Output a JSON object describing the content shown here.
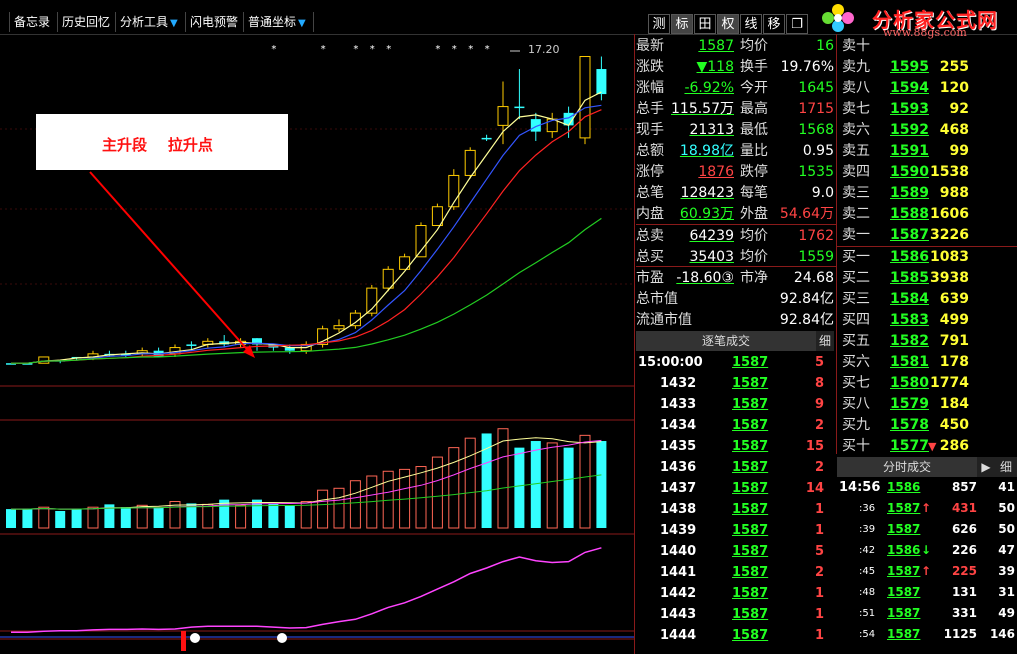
{
  "toolbar": {
    "items": [
      {
        "label": "备忘录"
      },
      {
        "label": "历史回忆"
      },
      {
        "label": "分析工具",
        "dropdown": true
      },
      {
        "label": "闪电预警"
      },
      {
        "label": "普通坐标",
        "dropdown": true
      }
    ],
    "right_buttons": [
      "测",
      "标",
      "田",
      "权",
      "线",
      "移",
      "❐"
    ],
    "brand_name": "分析家公式网",
    "brand_url": "www.88gs.com"
  },
  "annotation": {
    "text": "主升段    拉升点"
  },
  "chart_data": [
    {
      "type": "candlestick",
      "title": "",
      "xlabel": "",
      "ylabel": "",
      "peak_label": "17.20",
      "candles": [
        {
          "o": 12.3,
          "c": 12.3,
          "h": 12.3,
          "l": 12.3,
          "up": false
        },
        {
          "o": 12.3,
          "c": 12.3,
          "h": 12.3,
          "l": 12.3,
          "up": false
        },
        {
          "o": 12.3,
          "c": 12.4,
          "h": 12.4,
          "l": 12.3,
          "up": true
        },
        {
          "o": 12.35,
          "c": 12.35,
          "h": 12.35,
          "l": 12.3,
          "up": false
        },
        {
          "o": 12.4,
          "c": 12.4,
          "h": 12.4,
          "l": 12.35,
          "up": false
        },
        {
          "o": 12.4,
          "c": 12.45,
          "h": 12.5,
          "l": 12.35,
          "up": true
        },
        {
          "o": 12.45,
          "c": 12.45,
          "h": 12.5,
          "l": 12.4,
          "up": false
        },
        {
          "o": 12.45,
          "c": 12.45,
          "h": 12.5,
          "l": 12.4,
          "up": false
        },
        {
          "o": 12.45,
          "c": 12.5,
          "h": 12.55,
          "l": 12.4,
          "up": true
        },
        {
          "o": 12.5,
          "c": 12.4,
          "h": 12.55,
          "l": 12.4,
          "up": false
        },
        {
          "o": 12.45,
          "c": 12.55,
          "h": 12.6,
          "l": 12.4,
          "up": true
        },
        {
          "o": 12.6,
          "c": 12.6,
          "h": 12.65,
          "l": 12.5,
          "up": false
        },
        {
          "o": 12.6,
          "c": 12.65,
          "h": 12.7,
          "l": 12.55,
          "up": true
        },
        {
          "o": 12.65,
          "c": 12.6,
          "h": 12.75,
          "l": 12.55,
          "up": false
        },
        {
          "o": 12.6,
          "c": 12.65,
          "h": 12.7,
          "l": 12.55,
          "up": true
        },
        {
          "o": 12.7,
          "c": 12.6,
          "h": 12.7,
          "l": 12.5,
          "up": false
        },
        {
          "o": 12.6,
          "c": 12.55,
          "h": 12.6,
          "l": 12.5,
          "up": false
        },
        {
          "o": 12.55,
          "c": 12.5,
          "h": 12.6,
          "l": 12.45,
          "up": false
        },
        {
          "o": 12.5,
          "c": 12.6,
          "h": 12.65,
          "l": 12.45,
          "up": true
        },
        {
          "o": 12.6,
          "c": 12.85,
          "h": 12.9,
          "l": 12.55,
          "up": true
        },
        {
          "o": 12.85,
          "c": 12.9,
          "h": 13.0,
          "l": 12.8,
          "up": true
        },
        {
          "o": 12.9,
          "c": 13.1,
          "h": 13.15,
          "l": 12.85,
          "up": true
        },
        {
          "o": 13.1,
          "c": 13.5,
          "h": 13.55,
          "l": 13.05,
          "up": true
        },
        {
          "o": 13.5,
          "c": 13.8,
          "h": 13.85,
          "l": 13.45,
          "up": true
        },
        {
          "o": 13.8,
          "c": 14.0,
          "h": 14.05,
          "l": 13.8,
          "up": true
        },
        {
          "o": 14.0,
          "c": 14.5,
          "h": 14.55,
          "l": 14.0,
          "up": true
        },
        {
          "o": 14.5,
          "c": 14.8,
          "h": 14.85,
          "l": 14.5,
          "up": true
        },
        {
          "o": 14.8,
          "c": 15.3,
          "h": 15.4,
          "l": 14.75,
          "up": true
        },
        {
          "o": 15.3,
          "c": 15.7,
          "h": 15.75,
          "l": 15.25,
          "up": true
        },
        {
          "o": 15.9,
          "c": 15.9,
          "h": 15.95,
          "l": 15.85,
          "up": false
        },
        {
          "o": 16.1,
          "c": 16.4,
          "h": 16.8,
          "l": 15.8,
          "up": true
        },
        {
          "o": 16.4,
          "c": 16.4,
          "h": 17.0,
          "l": 16.2,
          "up": false
        },
        {
          "o": 16.2,
          "c": 16.0,
          "h": 16.3,
          "l": 15.85,
          "up": false
        },
        {
          "o": 16.0,
          "c": 16.2,
          "h": 16.3,
          "l": 15.9,
          "up": true
        },
        {
          "o": 16.3,
          "c": 16.1,
          "h": 16.4,
          "l": 15.9,
          "up": false
        },
        {
          "o": 15.9,
          "c": 17.2,
          "h": 17.2,
          "l": 15.8,
          "up": true
        },
        {
          "o": 17.0,
          "c": 16.6,
          "h": 17.2,
          "l": 16.5,
          "up": false
        }
      ],
      "volume": [
        20,
        20,
        22,
        18,
        20,
        22,
        25,
        22,
        24,
        22,
        28,
        26,
        25,
        30,
        24,
        30,
        26,
        24,
        28,
        40,
        42,
        50,
        55,
        60,
        62,
        65,
        75,
        85,
        95,
        100,
        105,
        85,
        92,
        90,
        85,
        98,
        92
      ],
      "volume_up": [
        false,
        false,
        true,
        false,
        false,
        true,
        false,
        false,
        true,
        false,
        true,
        false,
        true,
        false,
        true,
        false,
        false,
        false,
        true,
        true,
        true,
        true,
        true,
        true,
        true,
        true,
        true,
        true,
        true,
        false,
        true,
        false,
        false,
        true,
        false,
        true,
        false
      ]
    }
  ],
  "quote": {
    "rows": [
      {
        "l1": "最新",
        "v1": "1587",
        "c1": "green",
        "l2": "均价",
        "v2": "16",
        "c2": "green"
      },
      {
        "l1": "涨跌",
        "v1": "▼118",
        "c1": "green",
        "l2": "换手",
        "v2": "19.76%",
        "c2": "white"
      },
      {
        "l1": "涨幅",
        "v1": "-6.92%",
        "c1": "green",
        "l2": "今开",
        "v2": "1645",
        "c2": "green"
      },
      {
        "l1": "总手",
        "v1": "115.57万",
        "c1": "white",
        "l2": "最高",
        "v2": "1715",
        "c2": "red"
      },
      {
        "l1": "现手",
        "v1": "21313",
        "c1": "white",
        "l2": "最低",
        "v2": "1568",
        "c2": "green"
      },
      {
        "l1": "总额",
        "v1": "18.98亿",
        "c1": "cyan",
        "l2": "量比",
        "v2": "0.95",
        "c2": "white"
      },
      {
        "l1": "涨停",
        "v1": "1876",
        "c1": "red",
        "l2": "跌停",
        "v2": "1535",
        "c2": "green"
      },
      {
        "l1": "总笔",
        "v1": "128423",
        "c1": "white",
        "l2": "每笔",
        "v2": "9.0",
        "c2": "white"
      },
      {
        "l1": "内盘",
        "v1": "60.93万",
        "c1": "green",
        "l2": "外盘",
        "v2": "54.64万",
        "c2": "red"
      }
    ],
    "rows2": [
      {
        "l1": "总卖",
        "v1": "64239",
        "c1": "white",
        "l2": "均价",
        "v2": "1762",
        "c2": "red"
      },
      {
        "l1": "总买",
        "v1": "35403",
        "c1": "white",
        "l2": "均价",
        "v2": "1559",
        "c2": "green"
      }
    ],
    "pe_label": "市盈",
    "pe_value": "-18.60③",
    "pb_label": "市净",
    "pb_value": "24.68",
    "mcap_label": "总市值",
    "mcap_value": "92.84亿",
    "float_label": "流通市值",
    "float_value": "92.84亿"
  },
  "order_book": {
    "asks": [
      {
        "label": "卖十",
        "price": "",
        "vol": ""
      },
      {
        "label": "卖九",
        "price": "1595",
        "vol": "255"
      },
      {
        "label": "卖八",
        "price": "1594",
        "vol": "120"
      },
      {
        "label": "卖七",
        "price": "1593",
        "vol": "92"
      },
      {
        "label": "卖六",
        "price": "1592",
        "vol": "468"
      },
      {
        "label": "卖五",
        "price": "1591",
        "vol": "99"
      },
      {
        "label": "卖四",
        "price": "1590",
        "vol": "1538"
      },
      {
        "label": "卖三",
        "price": "1589",
        "vol": "988"
      },
      {
        "label": "卖二",
        "price": "1588",
        "vol": "1606"
      },
      {
        "label": "卖一",
        "price": "1587",
        "vol": "3226"
      }
    ],
    "bids": [
      {
        "label": "买一",
        "price": "1586",
        "vol": "1083"
      },
      {
        "label": "买二",
        "price": "1585",
        "vol": "3938"
      },
      {
        "label": "买三",
        "price": "1584",
        "vol": "639"
      },
      {
        "label": "买四",
        "price": "1583",
        "vol": "499"
      },
      {
        "label": "买五",
        "price": "1582",
        "vol": "791"
      },
      {
        "label": "买六",
        "price": "1581",
        "vol": "178"
      },
      {
        "label": "买七",
        "price": "1580",
        "vol": "1774"
      },
      {
        "label": "买八",
        "price": "1579",
        "vol": "184"
      },
      {
        "label": "买九",
        "price": "1578",
        "vol": "450"
      },
      {
        "label": "买十",
        "price": "1577",
        "vol": "286",
        "arrow": "▼"
      }
    ]
  },
  "tick_trades": {
    "header": "逐笔成交",
    "detail": "细",
    "rows": [
      {
        "t": "15:00:00",
        "p": "1587",
        "v": "5"
      },
      {
        "t": "1432",
        "p": "1587",
        "v": "8"
      },
      {
        "t": "1433",
        "p": "1587",
        "v": "9"
      },
      {
        "t": "1434",
        "p": "1587",
        "v": "2"
      },
      {
        "t": "1435",
        "p": "1587",
        "v": "15"
      },
      {
        "t": "1436",
        "p": "1587",
        "v": "2"
      },
      {
        "t": "1437",
        "p": "1587",
        "v": "14"
      },
      {
        "t": "1438",
        "p": "1587",
        "v": "1"
      },
      {
        "t": "1439",
        "p": "1587",
        "v": "1"
      },
      {
        "t": "1440",
        "p": "1587",
        "v": "5"
      },
      {
        "t": "1441",
        "p": "1587",
        "v": "2"
      },
      {
        "t": "1442",
        "p": "1587",
        "v": "1"
      },
      {
        "t": "1443",
        "p": "1587",
        "v": "1"
      },
      {
        "t": "1444",
        "p": "1587",
        "v": "1"
      }
    ]
  },
  "time_trades": {
    "header": "分时成交",
    "rows": [
      {
        "t": "14:56",
        "p": "1586",
        "arrow": "",
        "v": "857",
        "n": "41",
        "pc": "green"
      },
      {
        "t": ":36",
        "p": "1587",
        "arrow": "↑",
        "v": "431",
        "n": "50",
        "pc": "green",
        "vc": "red"
      },
      {
        "t": ":39",
        "p": "1587",
        "arrow": "",
        "v": "626",
        "n": "50",
        "pc": "green"
      },
      {
        "t": ":42",
        "p": "1586",
        "arrow": "↓",
        "v": "226",
        "n": "47",
        "pc": "green"
      },
      {
        "t": ":45",
        "p": "1587",
        "arrow": "↑",
        "v": "225",
        "n": "39",
        "pc": "green",
        "vc": "red"
      },
      {
        "t": ":48",
        "p": "1587",
        "arrow": "",
        "v": "131",
        "n": "31",
        "pc": "green"
      },
      {
        "t": ":51",
        "p": "1587",
        "arrow": "",
        "v": "331",
        "n": "49",
        "pc": "green"
      },
      {
        "t": ":54",
        "p": "1587",
        "arrow": "",
        "v": "1125",
        "n": "146",
        "pc": "green"
      }
    ]
  },
  "colors": {
    "up": "#ffcc00",
    "down": "#33ffff",
    "ma5": "#ffff99",
    "ma10": "#3355ff",
    "ma20": "#ff2222",
    "ma60": "#22cc22",
    "indicator": "#ff44ff",
    "grid": "#8a1a1a",
    "arrow": "#ff0000"
  }
}
